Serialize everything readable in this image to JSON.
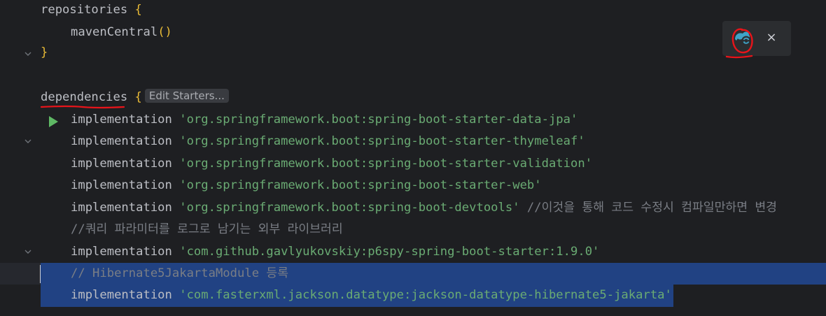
{
  "lines": [
    {
      "t1": "repositories ",
      "brace": "{"
    },
    {
      "t1": "mavenCentral",
      "paren": "()"
    },
    {
      "brace": "}"
    },
    {},
    {
      "t1": "dependencies ",
      "brace": "{",
      "hint": "Edit Starters..."
    },
    {
      "kw": "implementation ",
      "str": "'org.springframework.boot:spring-boot-starter-data-jpa'"
    },
    {
      "kw": "implementation ",
      "str": "'org.springframework.boot:spring-boot-starter-thymeleaf'"
    },
    {
      "kw": "implementation ",
      "str": "'org.springframework.boot:spring-boot-starter-validation'"
    },
    {
      "kw": "implementation ",
      "str": "'org.springframework.boot:spring-boot-starter-web'"
    },
    {
      "kw": "implementation ",
      "str": "'org.springframework.boot:spring-boot-devtools'",
      "cmt": " //이것을 통해 코드 수정시 컴파일만하면 변경"
    },
    {
      "cmt": "//쿼리 파라미터를 로그로 남기는 외부 라이브러리"
    },
    {
      "kw": "implementation ",
      "str": "'com.github.gavlyukovskiy:p6spy-spring-boot-starter:1.9.0'"
    },
    {
      "cmt": "// Hibernate5JakartaModule 등록"
    },
    {
      "kw": "implementation ",
      "str": "'com.fasterxml.jackson.datatype:jackson-datatype-hibernate5-jakarta'"
    }
  ],
  "popup": {
    "close_label": "×"
  },
  "icons": {
    "run": "run-gutter-icon",
    "bulb": "intention-bulb-icon",
    "sync": "gradle-sync-icon",
    "fold": "fold-chevron-icon"
  },
  "colors": {
    "background": "#1e1f22",
    "selection": "#214283",
    "string": "#6aab73",
    "comment": "#7a7e85",
    "brace": "#e8ba36",
    "annotation_red": "#e8141a"
  }
}
